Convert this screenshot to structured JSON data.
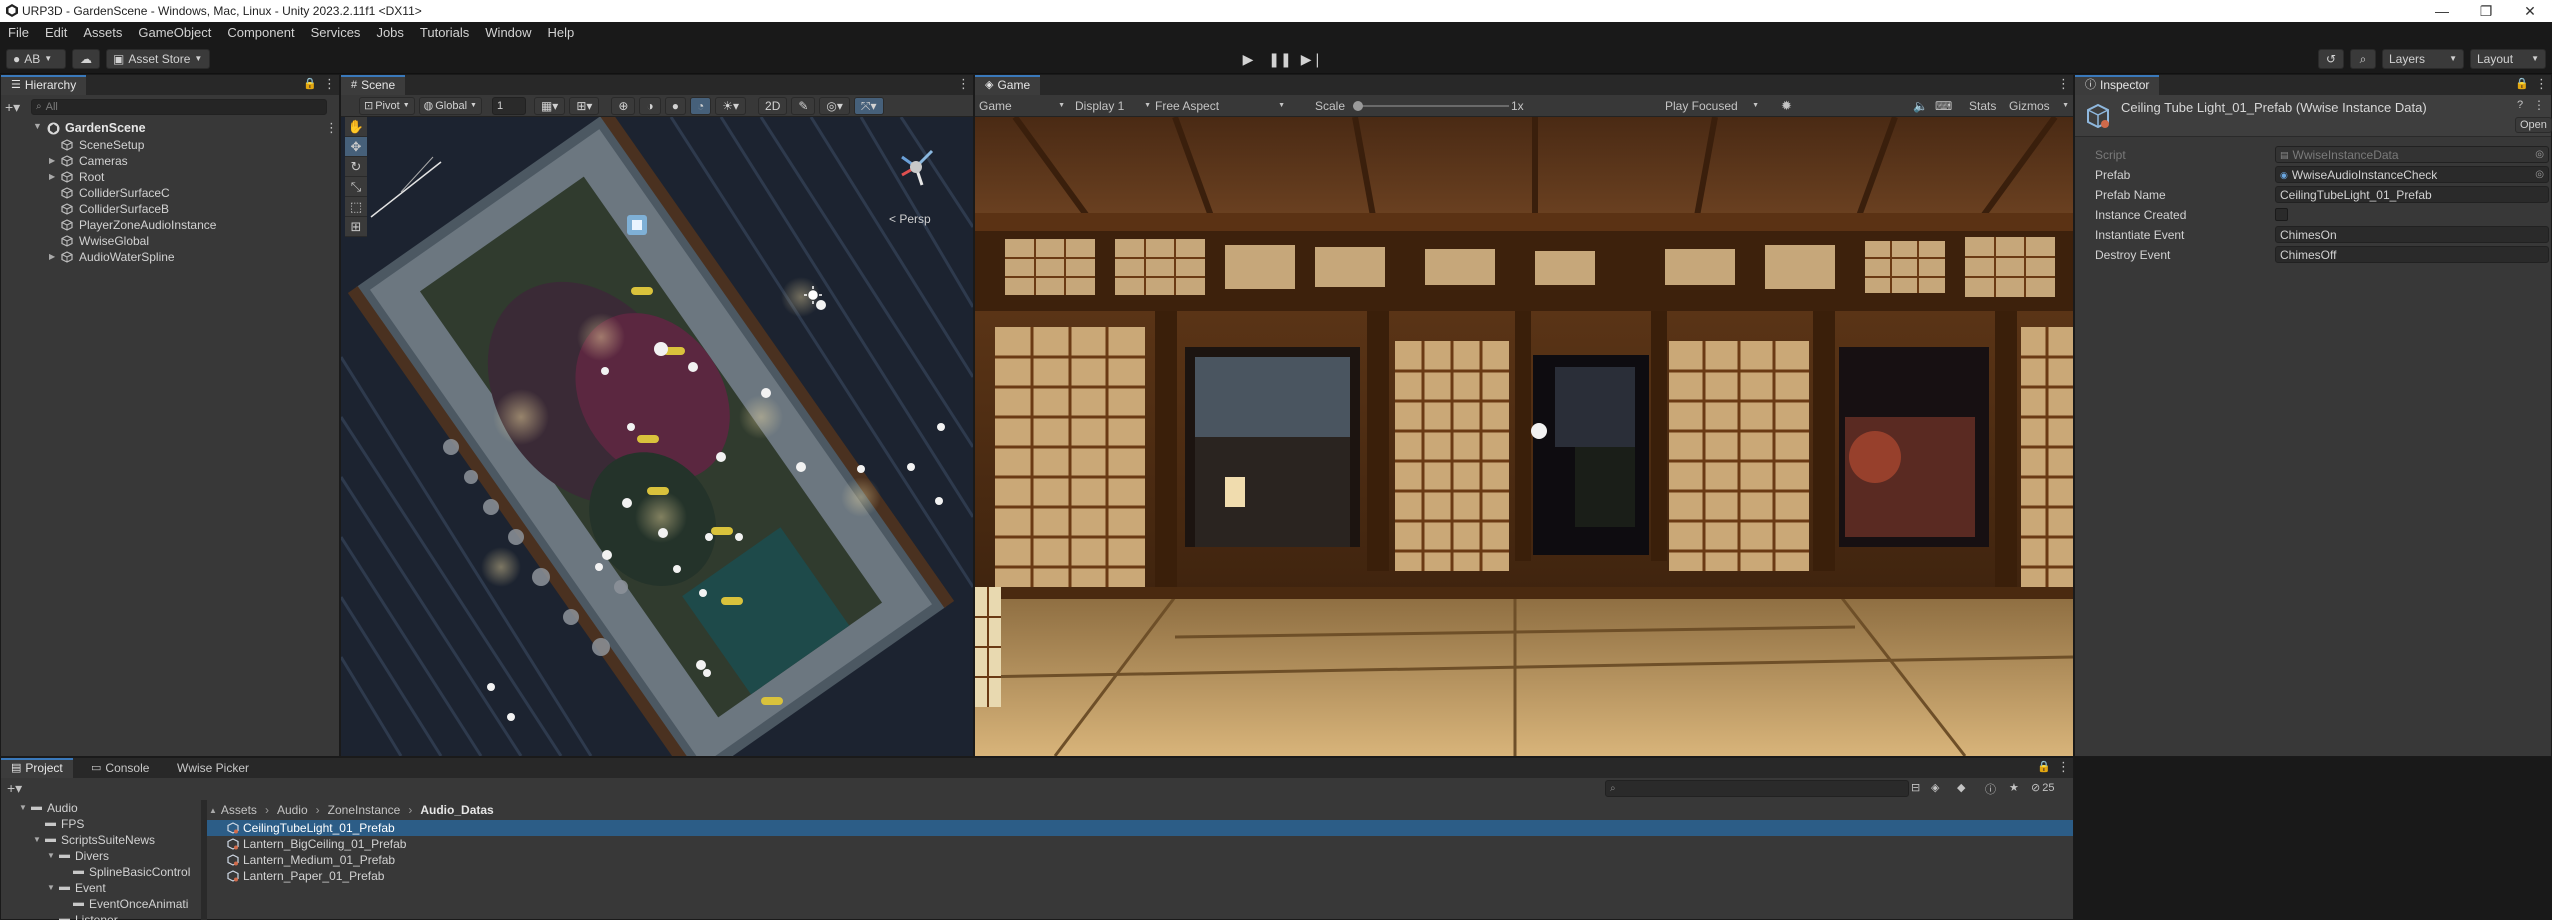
{
  "window": {
    "title": "URP3D - GardenScene - Windows, Mac, Linux - Unity 2023.2.11f1 <DX11>",
    "minimize": "—",
    "maximize": "❐",
    "close": "✕"
  },
  "menu": [
    "File",
    "Edit",
    "Assets",
    "GameObject",
    "Component",
    "Services",
    "Jobs",
    "Tutorials",
    "Window",
    "Help"
  ],
  "toolbar": {
    "account": "AB",
    "asset_store": "Asset Store",
    "layers": "Layers",
    "layout": "Layout"
  },
  "hierarchy": {
    "tab": "Hierarchy",
    "search_placeholder": "All",
    "scene": "GardenScene",
    "items": [
      {
        "label": "SceneSetup",
        "expandable": false
      },
      {
        "label": "Cameras",
        "expandable": true
      },
      {
        "label": "Root",
        "expandable": true
      },
      {
        "label": "ColliderSurfaceC",
        "expandable": false
      },
      {
        "label": "ColliderSurfaceB",
        "expandable": false
      },
      {
        "label": "PlayerZoneAudioInstance",
        "expandable": false
      },
      {
        "label": "WwiseGlobal",
        "expandable": false
      },
      {
        "label": "AudioWaterSpline",
        "expandable": true
      }
    ]
  },
  "scene_view": {
    "tab": "Scene",
    "pivot": "Pivot",
    "global": "Global",
    "grid_value": "1",
    "mode_2d": "2D",
    "persp": "< Persp"
  },
  "game_view": {
    "tab": "Game",
    "mode": "Game",
    "display": "Display 1",
    "aspect": "Free Aspect",
    "scale_label": "Scale",
    "scale_value": "1x",
    "scale_level": 0.0,
    "play_focused": "Play Focused",
    "stats": "Stats",
    "gizmos": "Gizmos"
  },
  "inspector": {
    "tab": "Inspector",
    "title": "Ceiling Tube Light_01_Prefab (Wwise Instance Data)",
    "open_button": "Open",
    "fields": [
      {
        "label": "Script",
        "value": "WwiseInstanceData",
        "disabled": true
      },
      {
        "label": "Prefab",
        "value": "WwiseAudioInstanceCheck",
        "disabled": false
      },
      {
        "label": "Prefab Name",
        "value": "CeilingTubeLight_01_Prefab",
        "disabled": false
      },
      {
        "label": "Instance Created",
        "value": "",
        "disabled": false,
        "checkbox": true
      },
      {
        "label": "Instantiate Event",
        "value": "ChimesOn",
        "disabled": false
      },
      {
        "label": "Destroy Event",
        "value": "ChimesOff",
        "disabled": false
      }
    ]
  },
  "project": {
    "tabs": [
      "Project",
      "Console",
      "Wwise Picker"
    ],
    "tree": [
      {
        "label": "Audio",
        "depth": 0,
        "expanded": true
      },
      {
        "label": "FPS",
        "depth": 1,
        "expanded": false
      },
      {
        "label": "ScriptsSuiteNews",
        "depth": 1,
        "expanded": true
      },
      {
        "label": "Divers",
        "depth": 2,
        "expanded": true
      },
      {
        "label": "SplineBasicControl",
        "depth": 3,
        "expanded": false
      },
      {
        "label": "Event",
        "depth": 2,
        "expanded": true
      },
      {
        "label": "EventOnceAnimati",
        "depth": 3,
        "expanded": false
      },
      {
        "label": "Listener",
        "depth": 2,
        "expanded": false
      }
    ],
    "breadcrumb": [
      "Assets",
      "Audio",
      "ZoneInstance",
      "Audio_Datas"
    ],
    "hidden_count": "25",
    "files": [
      {
        "label": "CeilingTubeLight_01_Prefab",
        "selected": true
      },
      {
        "label": "Lantern_BigCeiling_01_Prefab",
        "selected": false
      },
      {
        "label": "Lantern_Medium_01_Prefab",
        "selected": false
      },
      {
        "label": "Lantern_Paper_01_Prefab",
        "selected": false
      }
    ]
  },
  "colors": {
    "accent": "#3a79bb",
    "selection": "#2c5d87",
    "panel": "#383838",
    "dark": "#191919"
  }
}
